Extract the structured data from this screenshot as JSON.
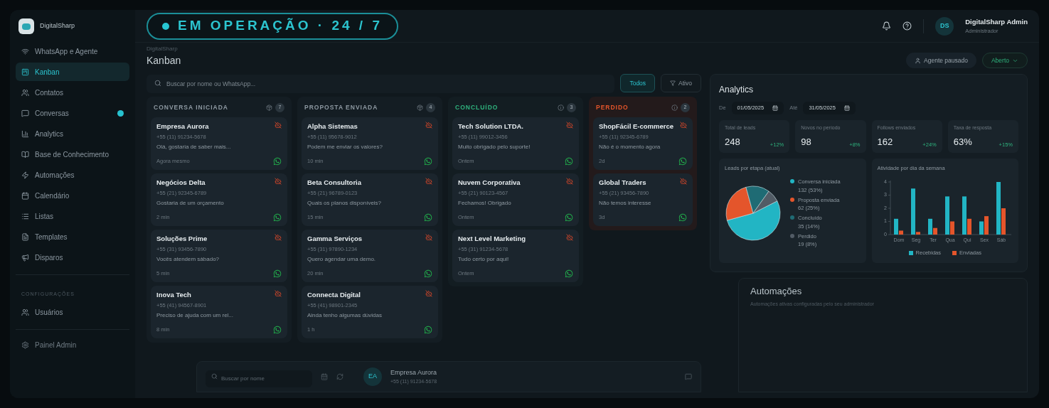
{
  "banner": {
    "text": "EM OPERAÇÃO · 24 / 7"
  },
  "sidebar": {
    "brand": "DigitalSharp",
    "items": [
      {
        "label": "WhatsApp e Agente",
        "selected": false,
        "badge": false
      },
      {
        "label": "Kanban",
        "selected": true,
        "badge": false
      },
      {
        "label": "Contatos",
        "selected": false,
        "badge": false
      },
      {
        "label": "Conversas",
        "selected": false,
        "badge": true
      },
      {
        "label": "Analytics",
        "selected": false,
        "badge": false
      },
      {
        "label": "Base de Conhecimento",
        "selected": false,
        "badge": false
      },
      {
        "label": "Automações",
        "selected": false,
        "badge": false
      },
      {
        "label": "Calendário",
        "selected": false,
        "badge": false
      },
      {
        "label": "Listas",
        "selected": false,
        "badge": false
      },
      {
        "label": "Templates",
        "selected": false,
        "badge": false
      },
      {
        "label": "Disparos",
        "selected": false,
        "badge": false
      }
    ],
    "section": "CONFIGURAÇÕES",
    "settings_items": [
      {
        "label": "Usuários",
        "selected": false,
        "badge": false
      }
    ],
    "footer_item": {
      "label": "Painel Admin"
    }
  },
  "header": {
    "breadcrumb": "DigitalSharp",
    "title": "Kanban",
    "user": {
      "initials": "DS",
      "name": "DigitalSharp Admin",
      "role": "Administrador"
    },
    "agent_button": "Agente pausado",
    "status_dropdown": "Aberto"
  },
  "filters": {
    "search": {
      "placeholder": "Buscar por nome ou WhatsApp..."
    },
    "chips": [
      {
        "label": "Todos",
        "selected": true
      },
      {
        "label": "Ativo",
        "selected": false
      }
    ]
  },
  "columns": [
    {
      "title": "CONVERSA INICIADA",
      "kind": "neutral",
      "count": "7",
      "cards": [
        {
          "name": "Empresa Aurora",
          "phone": "+55 (11) 91234-5678",
          "message": "Olá, gostaria de saber mais...",
          "time": "Agora mesmo"
        },
        {
          "name": "Negócios Delta",
          "phone": "+55 (21) 92345-6789",
          "message": "Gostaria de um orçamento",
          "time": "2 min"
        },
        {
          "name": "Soluções Prime",
          "phone": "+55 (31) 93456-7890",
          "message": "Vocês atendem sábado?",
          "time": "5 min"
        },
        {
          "name": "Inova Tech",
          "phone": "+55 (41) 94567-8901",
          "message": "Preciso de ajuda com um rel...",
          "time": "8 min"
        }
      ]
    },
    {
      "title": "PROPOSTA ENVIADA",
      "kind": "neutral",
      "count": "4",
      "cards": [
        {
          "name": "Alpha Sistemas",
          "phone": "+55 (11) 95678-9012",
          "message": "Podem me enviar os valores?",
          "time": "10 min"
        },
        {
          "name": "Beta Consultoria",
          "phone": "+55 (21) 96789-0123",
          "message": "Quais os planos disponíveis?",
          "time": "15 min"
        },
        {
          "name": "Gamma Serviços",
          "phone": "+55 (31) 97890-1234",
          "message": "Quero agendar uma demo.",
          "time": "20 min"
        },
        {
          "name": "Connecta Digital",
          "phone": "+55 (41) 98901-2345",
          "message": "Ainda tenho algumas dúvidas",
          "time": "1 h"
        }
      ]
    },
    {
      "title": "CONCLUÍDO",
      "kind": "won",
      "count": "3",
      "cards": [
        {
          "name": "Tech Solution LTDA.",
          "phone": "+55 (11) 99012-3456",
          "message": "Muito obrigado pelo suporte!",
          "time": "Ontem"
        },
        {
          "name": "Nuvem Corporativa",
          "phone": "+55 (21) 90123-4567",
          "message": "Fechamos! Obrigado",
          "time": "Ontem"
        },
        {
          "name": "Next Level Marketing",
          "phone": "+55 (31) 91234-5678",
          "message": "Tudo certo por aqui!",
          "time": "Ontem"
        }
      ]
    },
    {
      "title": "PERDIDO",
      "kind": "lost",
      "count": "2",
      "cards": [
        {
          "name": "ShopFácil E-commerce",
          "phone": "+55 (11) 92345-6789",
          "message": "Não é o momento agora",
          "time": "2d"
        },
        {
          "name": "Global Traders",
          "phone": "+55 (21) 93456-7890",
          "message": "Não temos interesse",
          "time": "3d"
        }
      ]
    }
  ],
  "analytics": {
    "title": "Analytics",
    "from_label": "De",
    "from": "01/05/2025",
    "to_label": "Até",
    "to": "31/05/2025",
    "stats": [
      {
        "label": "Total de leads",
        "value": "248",
        "change": "+12%"
      },
      {
        "label": "Novos no período",
        "value": "98",
        "change": "+8%"
      },
      {
        "label": "Follows enviados",
        "value": "162",
        "change": "+24%"
      },
      {
        "label": "Taxa de resposta",
        "value": "63%",
        "change": "+15%"
      }
    ],
    "pie": {
      "chart_data": {
        "type": "pie",
        "title": "Leads por etapa (atual)",
        "categories": [
          "Conversa iniciada",
          "Proposta enviada",
          "Concluído",
          "Perdido"
        ],
        "values": [
          132,
          62,
          35,
          19
        ],
        "value_labels": [
          "132 (53%)",
          "62 (25%)",
          "35 (14%)",
          "19 (8%)"
        ],
        "legend": "right"
      }
    },
    "bars": {
      "chart_data": {
        "type": "bar",
        "title": "Atividade por dia da semana",
        "categories": [
          "Dom",
          "Seg",
          "Ter",
          "Qua",
          "Qui",
          "Sex",
          "Sáb"
        ],
        "yticks": [
          0,
          1,
          2,
          3,
          4
        ],
        "ylim": [
          0,
          4
        ],
        "legend": "bottom",
        "series": [
          {
            "name": "Recebidas",
            "color": "#22b5c4",
            "values": [
              1.2,
              3.5,
              1.2,
              2.9,
              2.9,
              1.0,
              4.0
            ]
          },
          {
            "name": "Enviadas",
            "color": "#e4552b",
            "values": [
              0.3,
              0.2,
              0.5,
              1.0,
              1.2,
              1.4,
              2.0
            ]
          }
        ]
      }
    }
  },
  "chat_panel": {
    "search": {
      "placeholder": "Buscar por nome"
    },
    "contact": {
      "initials": "EA",
      "name": "Empresa Aurora",
      "phone": "+55 (11) 91234-5678"
    }
  },
  "automations": {
    "title": "Automações",
    "subtitle": "Automações ativas configuradas pelo seu administrador"
  }
}
